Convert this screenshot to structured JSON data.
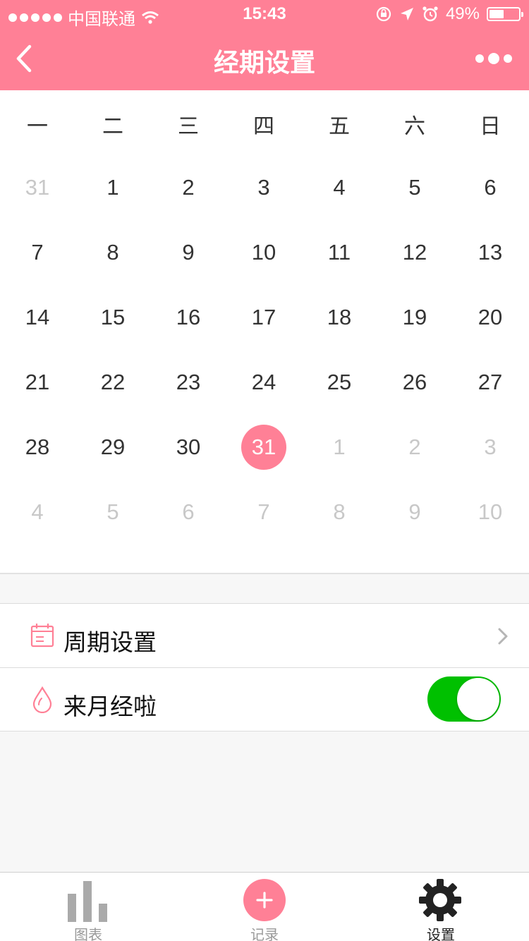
{
  "status_bar": {
    "carrier": "中国联通",
    "time": "15:43",
    "battery": "49%"
  },
  "nav": {
    "title": "经期设置"
  },
  "calendar": {
    "weekdays": [
      "一",
      "二",
      "三",
      "四",
      "五",
      "六",
      "日"
    ],
    "weeks": [
      [
        {
          "d": "31",
          "muted": true
        },
        {
          "d": "1"
        },
        {
          "d": "2"
        },
        {
          "d": "3"
        },
        {
          "d": "4"
        },
        {
          "d": "5"
        },
        {
          "d": "6"
        }
      ],
      [
        {
          "d": "7"
        },
        {
          "d": "8"
        },
        {
          "d": "9"
        },
        {
          "d": "10"
        },
        {
          "d": "11"
        },
        {
          "d": "12"
        },
        {
          "d": "13"
        }
      ],
      [
        {
          "d": "14"
        },
        {
          "d": "15"
        },
        {
          "d": "16"
        },
        {
          "d": "17"
        },
        {
          "d": "18"
        },
        {
          "d": "19"
        },
        {
          "d": "20"
        }
      ],
      [
        {
          "d": "21"
        },
        {
          "d": "22"
        },
        {
          "d": "23"
        },
        {
          "d": "24"
        },
        {
          "d": "25"
        },
        {
          "d": "26"
        },
        {
          "d": "27"
        }
      ],
      [
        {
          "d": "28"
        },
        {
          "d": "29"
        },
        {
          "d": "30"
        },
        {
          "d": "31",
          "selected": true
        },
        {
          "d": "1",
          "muted": true
        },
        {
          "d": "2",
          "muted": true
        },
        {
          "d": "3",
          "muted": true
        }
      ],
      [
        {
          "d": "4",
          "muted": true
        },
        {
          "d": "5",
          "muted": true
        },
        {
          "d": "6",
          "muted": true
        },
        {
          "d": "7",
          "muted": true
        },
        {
          "d": "8",
          "muted": true
        },
        {
          "d": "9",
          "muted": true
        },
        {
          "d": "10",
          "muted": true
        }
      ]
    ]
  },
  "settings": {
    "cycle_label": "周期设置",
    "period_label": "来月经啦",
    "period_toggle_on": true
  },
  "tabbar": {
    "chart_label": "图表",
    "record_label": "记录",
    "settings_label": "设置"
  },
  "colors": {
    "accent": "#ff8096",
    "toggle_on": "#00c000",
    "muted_text": "#c8c8c8"
  }
}
